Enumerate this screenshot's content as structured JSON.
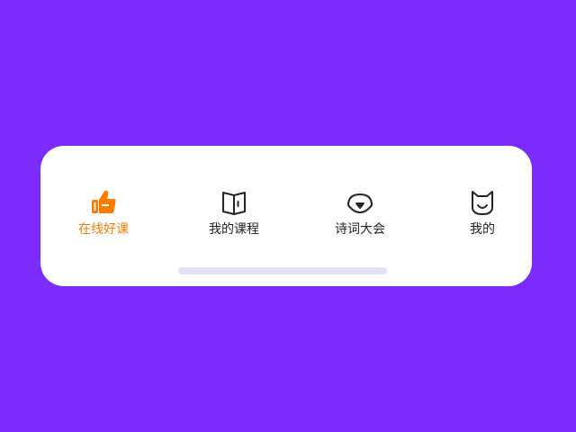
{
  "tabbar": {
    "items": [
      {
        "label": "在线好课",
        "icon": "thumbs-up-icon",
        "active": true
      },
      {
        "label": "我的课程",
        "icon": "book-icon",
        "active": false
      },
      {
        "label": "诗词大会",
        "icon": "chat-bubble-icon",
        "active": false
      },
      {
        "label": "我的",
        "icon": "cat-face-icon",
        "active": false
      }
    ]
  },
  "colors": {
    "background": "#7b2bfb",
    "active": "#ff7a00",
    "inactive": "#222222",
    "home_indicator": "#e3e1f5"
  }
}
